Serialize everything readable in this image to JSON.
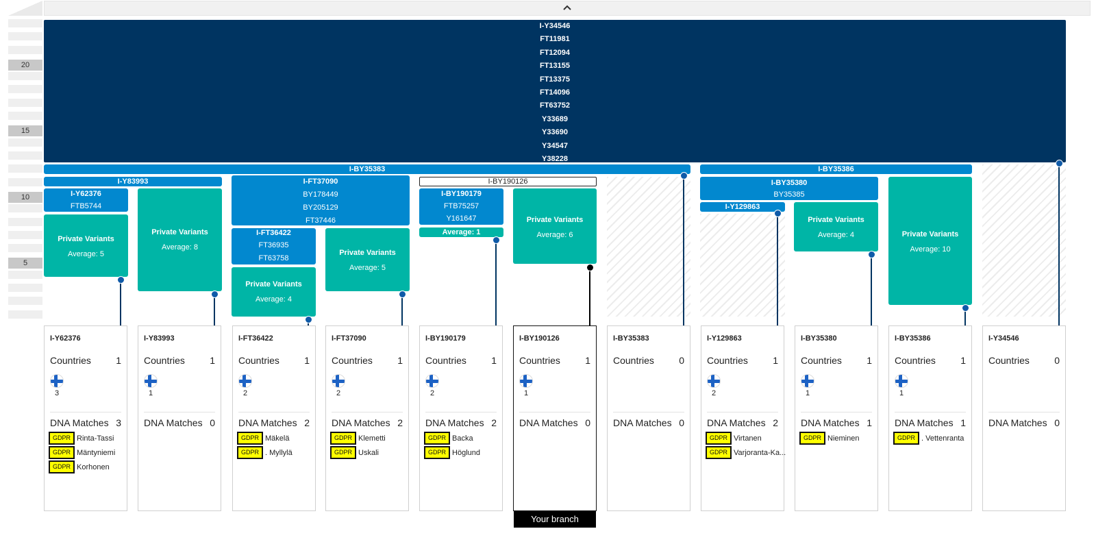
{
  "top_bar": {
    "icon": "chevron-up-icon"
  },
  "scale": {
    "labels": [
      "20",
      "15",
      "10",
      "5"
    ]
  },
  "root": {
    "lines": [
      "I-Y34546",
      "FT11981",
      "FT12094",
      "FT13155",
      "FT13375",
      "FT14096",
      "FT63752",
      "Y33689",
      "Y33690",
      "Y34547",
      "Y38228"
    ]
  },
  "branches": {
    "by35383": "I-BY35383",
    "by35386": "I-BY35386",
    "y83993": "I-Y83993",
    "ft37090": [
      "I-FT37090",
      "BY178449",
      "BY205129",
      "FT37446"
    ],
    "by190126": "I-BY190126",
    "y62376": [
      "I-Y62376",
      "FTB5744"
    ],
    "ft36422": [
      "I-FT36422",
      "FT36935",
      "FT63758"
    ],
    "by190179": [
      "I-BY190179",
      "FTB75257",
      "Y161647"
    ],
    "by190179_avg": "Average: 1",
    "by35380": [
      "I-BY35380",
      "BY35385"
    ],
    "y129863": "I-Y129863"
  },
  "private_variants": {
    "title": "Private Variants",
    "y62376": "Average: 5",
    "y83993": "Average: 8",
    "ft36422": "Average: 4",
    "ft37090": "Average: 5",
    "by190126": "Average: 6",
    "by35380": "Average: 4",
    "by35386": "Average: 10"
  },
  "card_labels": {
    "countries": "Countries",
    "dna_matches": "DNA Matches",
    "gdpr": "GDPR"
  },
  "cards": [
    {
      "name": "I-Y62376",
      "countries": "1",
      "flag_count": "3",
      "dna_matches": "3",
      "matches": [
        "Rinta-Tassi",
        "Mäntyniemi",
        "Korhonen"
      ]
    },
    {
      "name": "I-Y83993",
      "countries": "1",
      "flag_count": "1",
      "dna_matches": "0",
      "matches": []
    },
    {
      "name": "I-FT36422",
      "countries": "1",
      "flag_count": "2",
      "dna_matches": "2",
      "matches": [
        "Mäkelä",
        ". Myllylä"
      ]
    },
    {
      "name": "I-FT37090",
      "countries": "1",
      "flag_count": "2",
      "dna_matches": "2",
      "matches": [
        "Klemetti",
        "Uskali"
      ]
    },
    {
      "name": "I-BY190179",
      "countries": "1",
      "flag_count": "2",
      "dna_matches": "2",
      "matches": [
        "Backa",
        "Höglund"
      ]
    },
    {
      "name": "I-BY190126",
      "countries": "1",
      "flag_count": "1",
      "dna_matches": "0",
      "matches": []
    },
    {
      "name": "I-BY35383",
      "countries": "0",
      "flag_count": "",
      "dna_matches": "0",
      "matches": []
    },
    {
      "name": "I-Y129863",
      "countries": "1",
      "flag_count": "2",
      "dna_matches": "2",
      "matches": [
        "Virtanen",
        "Varjoranta-Ka..."
      ]
    },
    {
      "name": "I-BY35380",
      "countries": "1",
      "flag_count": "1",
      "dna_matches": "1",
      "matches": [
        "Nieminen"
      ]
    },
    {
      "name": "I-BY35386",
      "countries": "1",
      "flag_count": "1",
      "dna_matches": "1",
      "matches": [
        ". Vettenranta"
      ]
    },
    {
      "name": "I-Y34546",
      "countries": "0",
      "flag_count": "",
      "dna_matches": "0",
      "matches": []
    }
  ],
  "your_branch": "Your branch"
}
